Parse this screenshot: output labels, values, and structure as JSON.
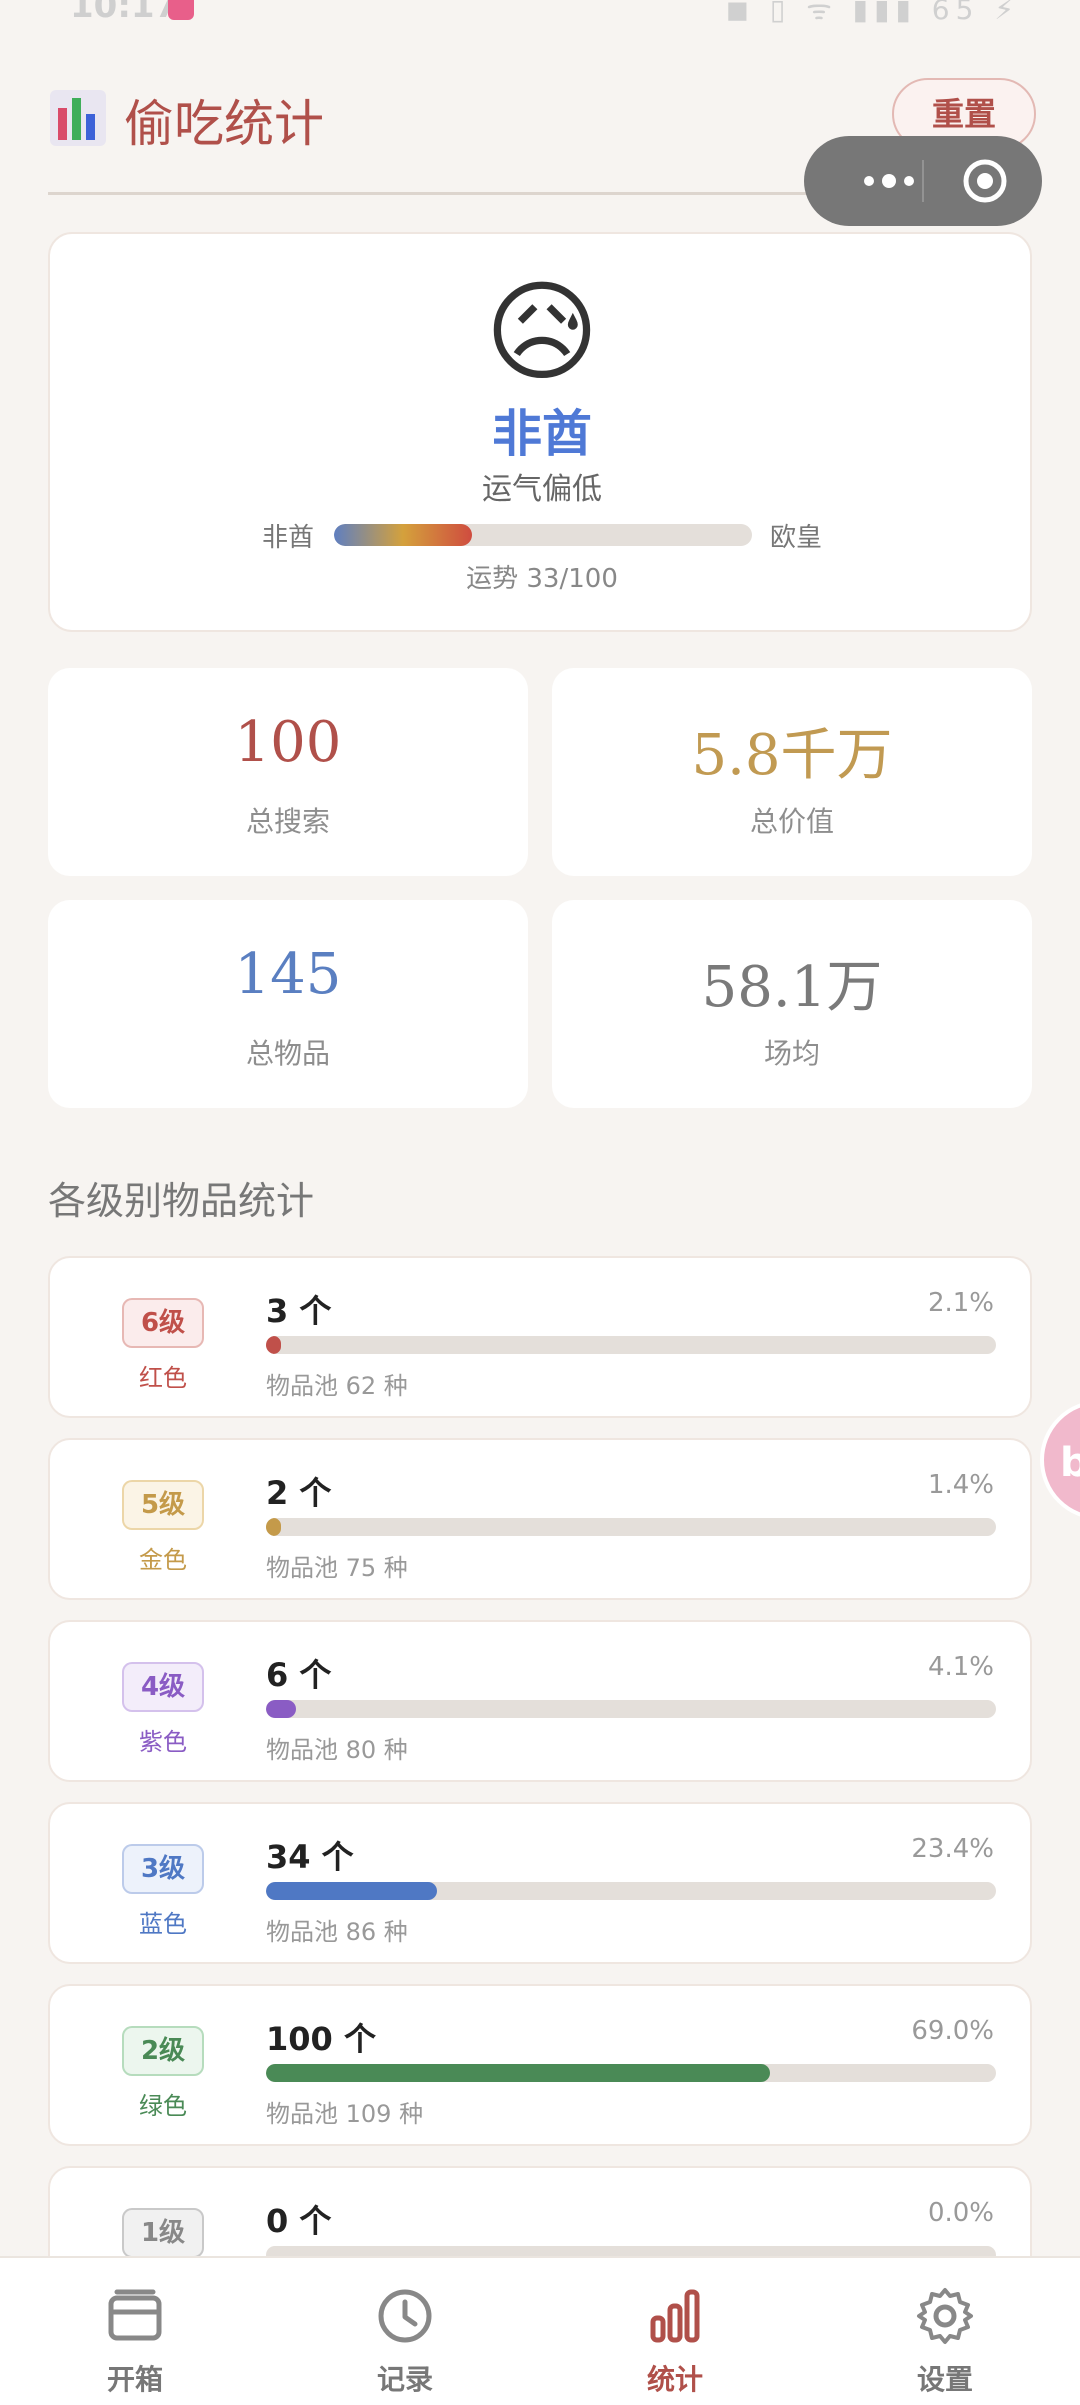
{
  "status_bar": {
    "time": "10:17",
    "right_text": "◼ ▯ ᯤ ▮▮▮ 65 ⚡"
  },
  "header": {
    "title": "偷吃统计",
    "reset_label": "重置"
  },
  "luck": {
    "emoji": "😥",
    "level_label": "非酋",
    "description": "运气偏低",
    "scale_left": "非酋",
    "scale_right": "欧皇",
    "score_text": "运势 33/100",
    "score_fraction": 0.33
  },
  "stats": [
    {
      "value": "100",
      "label": "总搜索",
      "color": "#b0504a"
    },
    {
      "value": "5.8千万",
      "label": "总价值",
      "color": "#c19a52"
    },
    {
      "value": "145",
      "label": "总物品",
      "color": "#5a7fc1"
    },
    {
      "value": "58.1万",
      "label": "场均",
      "color": "#7a7a7a"
    }
  ],
  "section_title": "各级别物品统计",
  "levels": [
    {
      "badge": "6级",
      "color_name": "红色",
      "count": "3 个",
      "pct": "2.1%",
      "fraction": 0.021,
      "pool": "物品池 62 种",
      "color": "#c0504a",
      "bg": "#fbecec",
      "border": "#e7b8b4"
    },
    {
      "badge": "5级",
      "color_name": "金色",
      "count": "2 个",
      "pct": "1.4%",
      "fraction": 0.014,
      "pool": "物品池 75 种",
      "color": "#c49a4a",
      "bg": "#fbf4e6",
      "border": "#ecd6a8"
    },
    {
      "badge": "4级",
      "color_name": "紫色",
      "count": "6 个",
      "pct": "4.1%",
      "fraction": 0.041,
      "pool": "物品池 80 种",
      "color": "#8a5cc4",
      "bg": "#f3edfa",
      "border": "#d4c1ec"
    },
    {
      "badge": "3级",
      "color_name": "蓝色",
      "count": "34 个",
      "pct": "23.4%",
      "fraction": 0.234,
      "pool": "物品池 86 种",
      "color": "#4f78c4",
      "bg": "#edf2fb",
      "border": "#bccbea"
    },
    {
      "badge": "2级",
      "color_name": "绿色",
      "count": "100 个",
      "pct": "69.0%",
      "fraction": 0.69,
      "pool": "物品池 109 种",
      "color": "#4a8a56",
      "bg": "#ecf6ee",
      "border": "#b6dcbd"
    },
    {
      "badge": "1级",
      "color_name": "",
      "count": "0 个",
      "pct": "0.0%",
      "fraction": 0.0,
      "pool": "",
      "color": "#888888",
      "bg": "#f1f1f1",
      "border": "#c9c9c9"
    }
  ],
  "nav": [
    {
      "label": "开箱",
      "icon": "box-icon",
      "active": false
    },
    {
      "label": "记录",
      "icon": "clock-icon",
      "active": false
    },
    {
      "label": "统计",
      "icon": "bar-chart-icon",
      "active": true
    },
    {
      "label": "设置",
      "icon": "gear-icon",
      "active": false
    }
  ]
}
